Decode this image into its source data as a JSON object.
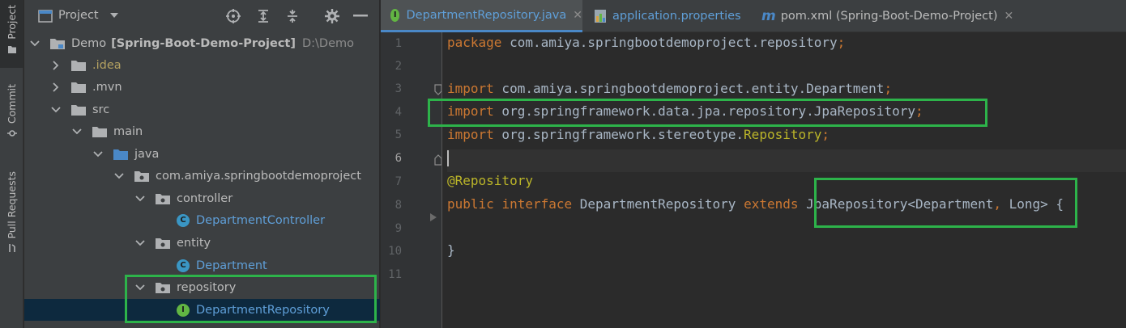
{
  "strip": {
    "tabs": [
      {
        "label": "Project",
        "icon": "folder-icon"
      },
      {
        "label": "Commit",
        "icon": "commit-icon"
      },
      {
        "label": "Pull Requests",
        "icon": "pull-request-icon"
      }
    ]
  },
  "project": {
    "title": "Project",
    "tree": [
      {
        "label": "Demo",
        "bold_label": "[Spring-Boot-Demo-Project]",
        "path": "D:\\Demo"
      },
      {
        "label": ".idea"
      },
      {
        "label": ".mvn"
      },
      {
        "label": "src"
      },
      {
        "label": "main"
      },
      {
        "label": "java"
      },
      {
        "label": "com.amiya.springbootdemoproject"
      },
      {
        "label": "controller"
      },
      {
        "label": "DepartmentController"
      },
      {
        "label": "entity"
      },
      {
        "label": "Department"
      },
      {
        "label": "repository"
      },
      {
        "label": "DepartmentRepository"
      }
    ]
  },
  "editor": {
    "tabs": [
      {
        "label": "DepartmentRepository.java",
        "active": true
      },
      {
        "label": "application.properties"
      },
      {
        "label": "pom.xml (Spring-Boot-Demo-Project)"
      }
    ],
    "line_numbers": [
      "1",
      "2",
      "3",
      "4",
      "5",
      "6",
      "7",
      "8",
      "9",
      "10",
      "11"
    ],
    "code": {
      "l1_kw": "package",
      "l1_rest": " com.amiya.springbootdemoproject.repository",
      "l1_semi": ";",
      "l3_kw": "import",
      "l3_rest": " com.amiya.springbootdemoproject.entity.Department",
      "l3_semi": ";",
      "l4_kw": "import",
      "l4_rest": " org.springframework.data.jpa.repository.JpaRepository",
      "l4_semi": ";",
      "l5_kw": "import",
      "l5_rest": " org.springframework.stereotype.",
      "l5_ann": "Repository",
      "l5_semi": ";",
      "l7_ann": "@Repository",
      "l8_kw1": "public",
      "l8_kw2": "interface",
      "l8_name": "DepartmentRepository",
      "l8_kw3": "extends",
      "l8_type": "JpaRepository<Department",
      "l8_comma": ",",
      "l8_type2": " Long>",
      "l8_brace": " {",
      "l10_brace": "}"
    }
  },
  "colors": {
    "highlight": "#2db34a",
    "keyword": "#cc7832",
    "annotation": "#bbb529",
    "selection": "#0d293e"
  }
}
